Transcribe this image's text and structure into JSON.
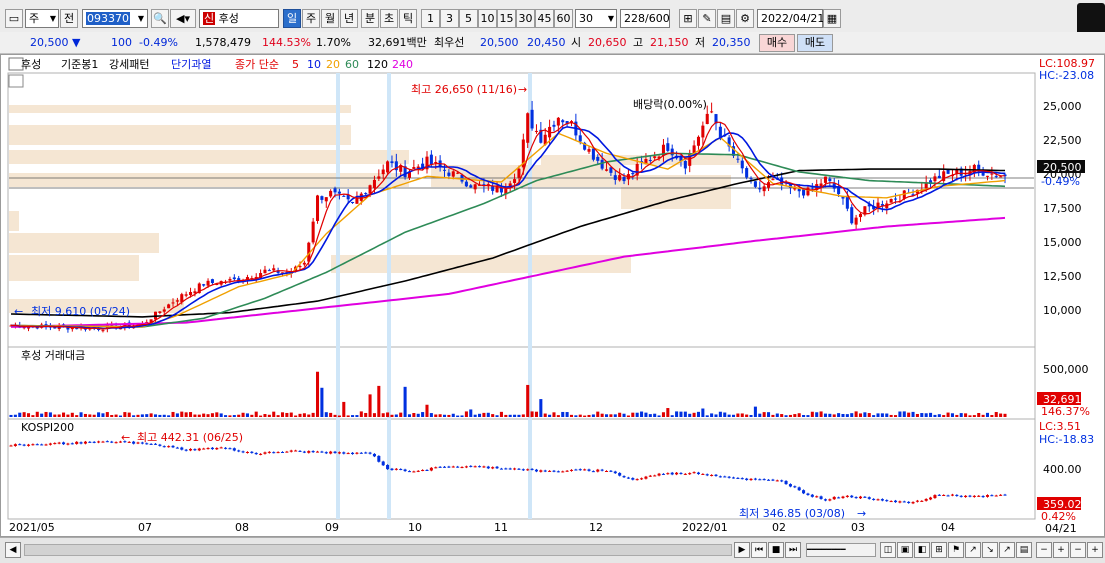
{
  "toolbar": {
    "period_select": "주",
    "prev_label": "전",
    "code": "093370",
    "stock_tag": "신",
    "stock_name": "후성",
    "tabs": [
      "일",
      "주",
      "월",
      "년",
      "분",
      "초",
      "틱"
    ],
    "active_tab": "일",
    "intervals": [
      "1",
      "3",
      "5",
      "10",
      "15",
      "30",
      "45",
      "60"
    ],
    "interval_select": "30",
    "count": "228/600",
    "date": "2022/04/21"
  },
  "quote": {
    "price": "20,500",
    "change": "100",
    "change_pct": "-0.49%",
    "volume": "1,578,479",
    "vol_ratio": "144.53%",
    "turnover": "1.70%",
    "amount": "32,691백만",
    "best_label": "최우선",
    "ask": "20,500",
    "bid": "20,450",
    "open_label": "시",
    "open": "20,650",
    "high_label": "고",
    "high": "21,150",
    "low_label": "저",
    "low": "20,350",
    "buy_label": "매수",
    "sell_label": "매도"
  },
  "legend": {
    "name": "후성",
    "items": [
      "기준봉1",
      "강세패턴",
      "단기과열",
      "종가 단순"
    ],
    "ma_periods": [
      "5",
      "10",
      "20",
      "60",
      "120",
      "240"
    ]
  },
  "colors": {
    "ma5": "#e00000",
    "ma10": "#0018e0",
    "ma20": "#f0a000",
    "ma60": "#2e8b57",
    "ma120": "#000000",
    "ma240": "#e000e0",
    "up": "#e00000",
    "down": "#0030e0",
    "box": "#f5e6d3"
  },
  "chart_data": [
    {
      "type": "candlestick",
      "title": "후성",
      "y_ticks": [
        "25,000",
        "22,500",
        "20,000",
        "17,500",
        "15,000",
        "12,500",
        "10,000"
      ],
      "ylim": [
        8600,
        27700
      ],
      "lc_label": "LC:108.97",
      "hc_label": "HC:-23.08",
      "last_price": "20,500",
      "last_change": "-0.49%",
      "annotations": {
        "high": "최고 26,650 (11/16)",
        "low": "최저 9,610 (05/24)",
        "dividend": "배당락(0.00%)"
      },
      "x_labels": [
        "2021/05",
        "07",
        "08",
        "09",
        "10",
        "11",
        "12",
        "2022/01",
        "02",
        "03",
        "04"
      ],
      "close_path": [
        [
          0,
          10100
        ],
        [
          10,
          10000
        ],
        [
          20,
          9900
        ],
        [
          30,
          10200
        ],
        [
          38,
          12000
        ],
        [
          44,
          13000
        ],
        [
          52,
          13300
        ],
        [
          58,
          13900
        ],
        [
          64,
          13800
        ],
        [
          67,
          14500
        ],
        [
          70,
          19000
        ],
        [
          73,
          19300
        ],
        [
          78,
          18500
        ],
        [
          82,
          20000
        ],
        [
          86,
          21400
        ],
        [
          90,
          20800
        ],
        [
          95,
          21500
        ],
        [
          100,
          20800
        ],
        [
          106,
          19800
        ],
        [
          112,
          19600
        ],
        [
          116,
          21000
        ],
        [
          118,
          24600
        ],
        [
          121,
          23200
        ],
        [
          125,
          24700
        ],
        [
          128,
          24100
        ],
        [
          132,
          22300
        ],
        [
          136,
          21000
        ],
        [
          140,
          20200
        ],
        [
          145,
          21600
        ],
        [
          150,
          22600
        ],
        [
          154,
          21400
        ],
        [
          158,
          24000
        ],
        [
          160,
          25000
        ],
        [
          162,
          23500
        ],
        [
          166,
          21400
        ],
        [
          170,
          19500
        ],
        [
          174,
          20100
        ],
        [
          178,
          19600
        ],
        [
          182,
          19400
        ],
        [
          186,
          20300
        ],
        [
          189,
          19300
        ],
        [
          192,
          17500
        ],
        [
          196,
          18300
        ],
        [
          200,
          18800
        ],
        [
          205,
          19300
        ],
        [
          208,
          19800
        ],
        [
          212,
          20500
        ],
        [
          216,
          20700
        ],
        [
          220,
          21000
        ],
        [
          224,
          20700
        ],
        [
          227,
          20500
        ]
      ],
      "ma_paths": {
        "ma20": [
          [
            0,
            10100
          ],
          [
            30,
            10000
          ],
          [
            38,
            10800
          ],
          [
            52,
            12800
          ],
          [
            64,
            13700
          ],
          [
            72,
            16500
          ],
          [
            82,
            19200
          ],
          [
            95,
            20500
          ],
          [
            112,
            20100
          ],
          [
            125,
            23500
          ],
          [
            136,
            22100
          ],
          [
            150,
            21000
          ],
          [
            162,
            23200
          ],
          [
            174,
            20000
          ],
          [
            190,
            19100
          ],
          [
            200,
            19000
          ],
          [
            212,
            19800
          ],
          [
            227,
            20200
          ]
        ],
        "ma60": [
          [
            0,
            10100
          ],
          [
            30,
            10000
          ],
          [
            44,
            10600
          ],
          [
            58,
            12000
          ],
          [
            72,
            13800
          ],
          [
            90,
            16600
          ],
          [
            108,
            18600
          ],
          [
            120,
            20200
          ],
          [
            136,
            21500
          ],
          [
            150,
            22100
          ],
          [
            166,
            22000
          ],
          [
            180,
            20800
          ],
          [
            196,
            20200
          ],
          [
            212,
            20000
          ],
          [
            227,
            19800
          ]
        ],
        "ma120": [
          [
            0,
            10900
          ],
          [
            30,
            10700
          ],
          [
            50,
            11000
          ],
          [
            70,
            11800
          ],
          [
            90,
            13200
          ],
          [
            110,
            14800
          ],
          [
            130,
            17000
          ],
          [
            150,
            18800
          ],
          [
            166,
            20000
          ],
          [
            180,
            20900
          ],
          [
            196,
            21000
          ],
          [
            212,
            21000
          ],
          [
            227,
            20900
          ]
        ],
        "ma240": [
          [
            0,
            10000
          ],
          [
            40,
            10300
          ],
          [
            70,
            11300
          ],
          [
            100,
            12300
          ],
          [
            120,
            13600
          ],
          [
            140,
            14900
          ],
          [
            170,
            16000
          ],
          [
            200,
            17000
          ],
          [
            227,
            17600
          ]
        ]
      }
    },
    {
      "type": "bar",
      "title": "후성 거래대금",
      "y_ticks": [
        "500,000",
        "0"
      ],
      "ylim": [
        0,
        700000
      ],
      "last_value": "32,691",
      "last_pct": "146.37%",
      "spikes": [
        [
          70,
          480000
        ],
        [
          71,
          310000
        ],
        [
          76,
          160000
        ],
        [
          82,
          240000
        ],
        [
          84,
          330000
        ],
        [
          90,
          320000
        ],
        [
          95,
          130000
        ],
        [
          105,
          80000
        ],
        [
          118,
          340000
        ],
        [
          121,
          190000
        ],
        [
          150,
          95000
        ],
        [
          158,
          90000
        ],
        [
          170,
          110000
        ]
      ]
    },
    {
      "type": "line",
      "title": "KOSPI200",
      "y_ticks": [
        "400.00"
      ],
      "ylim": [
        325,
        475
      ],
      "lc_label": "LC:3.51",
      "hc_label": "HC:-18.83",
      "last_value": "359.02",
      "last_change": "0.42%",
      "annotations": {
        "high": "최고 442.31 (06/25)",
        "low": "최저 346.85 (03/08)"
      },
      "x_last_label": "04/21",
      "path": [
        [
          0,
          437
        ],
        [
          15,
          441
        ],
        [
          25,
          442.3
        ],
        [
          33,
          438
        ],
        [
          40,
          430
        ],
        [
          48,
          433
        ],
        [
          56,
          424
        ],
        [
          64,
          428
        ],
        [
          72,
          426
        ],
        [
          78,
          424
        ],
        [
          82,
          425
        ],
        [
          86,
          400
        ],
        [
          92,
          397
        ],
        [
          100,
          404
        ],
        [
          108,
          403
        ],
        [
          116,
          400
        ],
        [
          122,
          396
        ],
        [
          130,
          398
        ],
        [
          136,
          398
        ],
        [
          142,
          383
        ],
        [
          148,
          392
        ],
        [
          156,
          394
        ],
        [
          162,
          389
        ],
        [
          168,
          384
        ],
        [
          176,
          381
        ],
        [
          182,
          360
        ],
        [
          186,
          352
        ],
        [
          190,
          358
        ],
        [
          196,
          354
        ],
        [
          200,
          351
        ],
        [
          206,
          346.9
        ],
        [
          212,
          360
        ],
        [
          220,
          357
        ],
        [
          227,
          359
        ]
      ]
    }
  ]
}
